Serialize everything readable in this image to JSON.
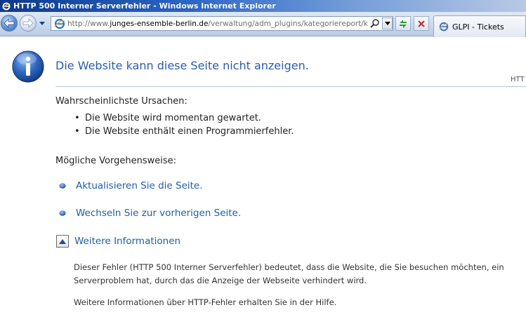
{
  "window": {
    "title": "HTTP 500 Interner Serverfehler - Windows Internet Explorer"
  },
  "toolbar": {
    "back_icon": "back-arrow-icon",
    "forward_icon": "forward-arrow-icon",
    "address": {
      "url_prefix": "http://www.",
      "url_host": "junges-ensemble-berlin.de",
      "url_path": "/verwaltung/adm_plugins/kategoriereport/kategor"
    },
    "tab": {
      "label": "GLPI - Tickets"
    }
  },
  "page": {
    "heading": "Die Website kann diese Seite nicht anzeigen.",
    "error_code": "HTT",
    "causes_title": "Wahrscheinlichste Ursachen:",
    "causes": [
      "Die Website wird momentan gewartet.",
      "Die Website enthält einen Programmierfehler."
    ],
    "actions_title": "Mögliche Vorgehensweise:",
    "actions": [
      "Aktualisieren Sie die Seite.",
      "Wechseln Sie zur vorherigen Seite."
    ],
    "more_info_label": "Weitere Informationen",
    "details": [
      "Dieser Fehler (HTTP 500 Interner Serverfehler) bedeutet, dass die Website, die Sie besuchen möchten, ein Serverproblem hat, durch das die Anzeige der Webseite verhindert wird.",
      "Weitere Informationen über HTTP-Fehler erhalten Sie in der Hilfe."
    ]
  },
  "colors": {
    "heading": "#2a5db0",
    "link": "#1f5ea8",
    "titlebar_start": "#0b3a8f"
  }
}
